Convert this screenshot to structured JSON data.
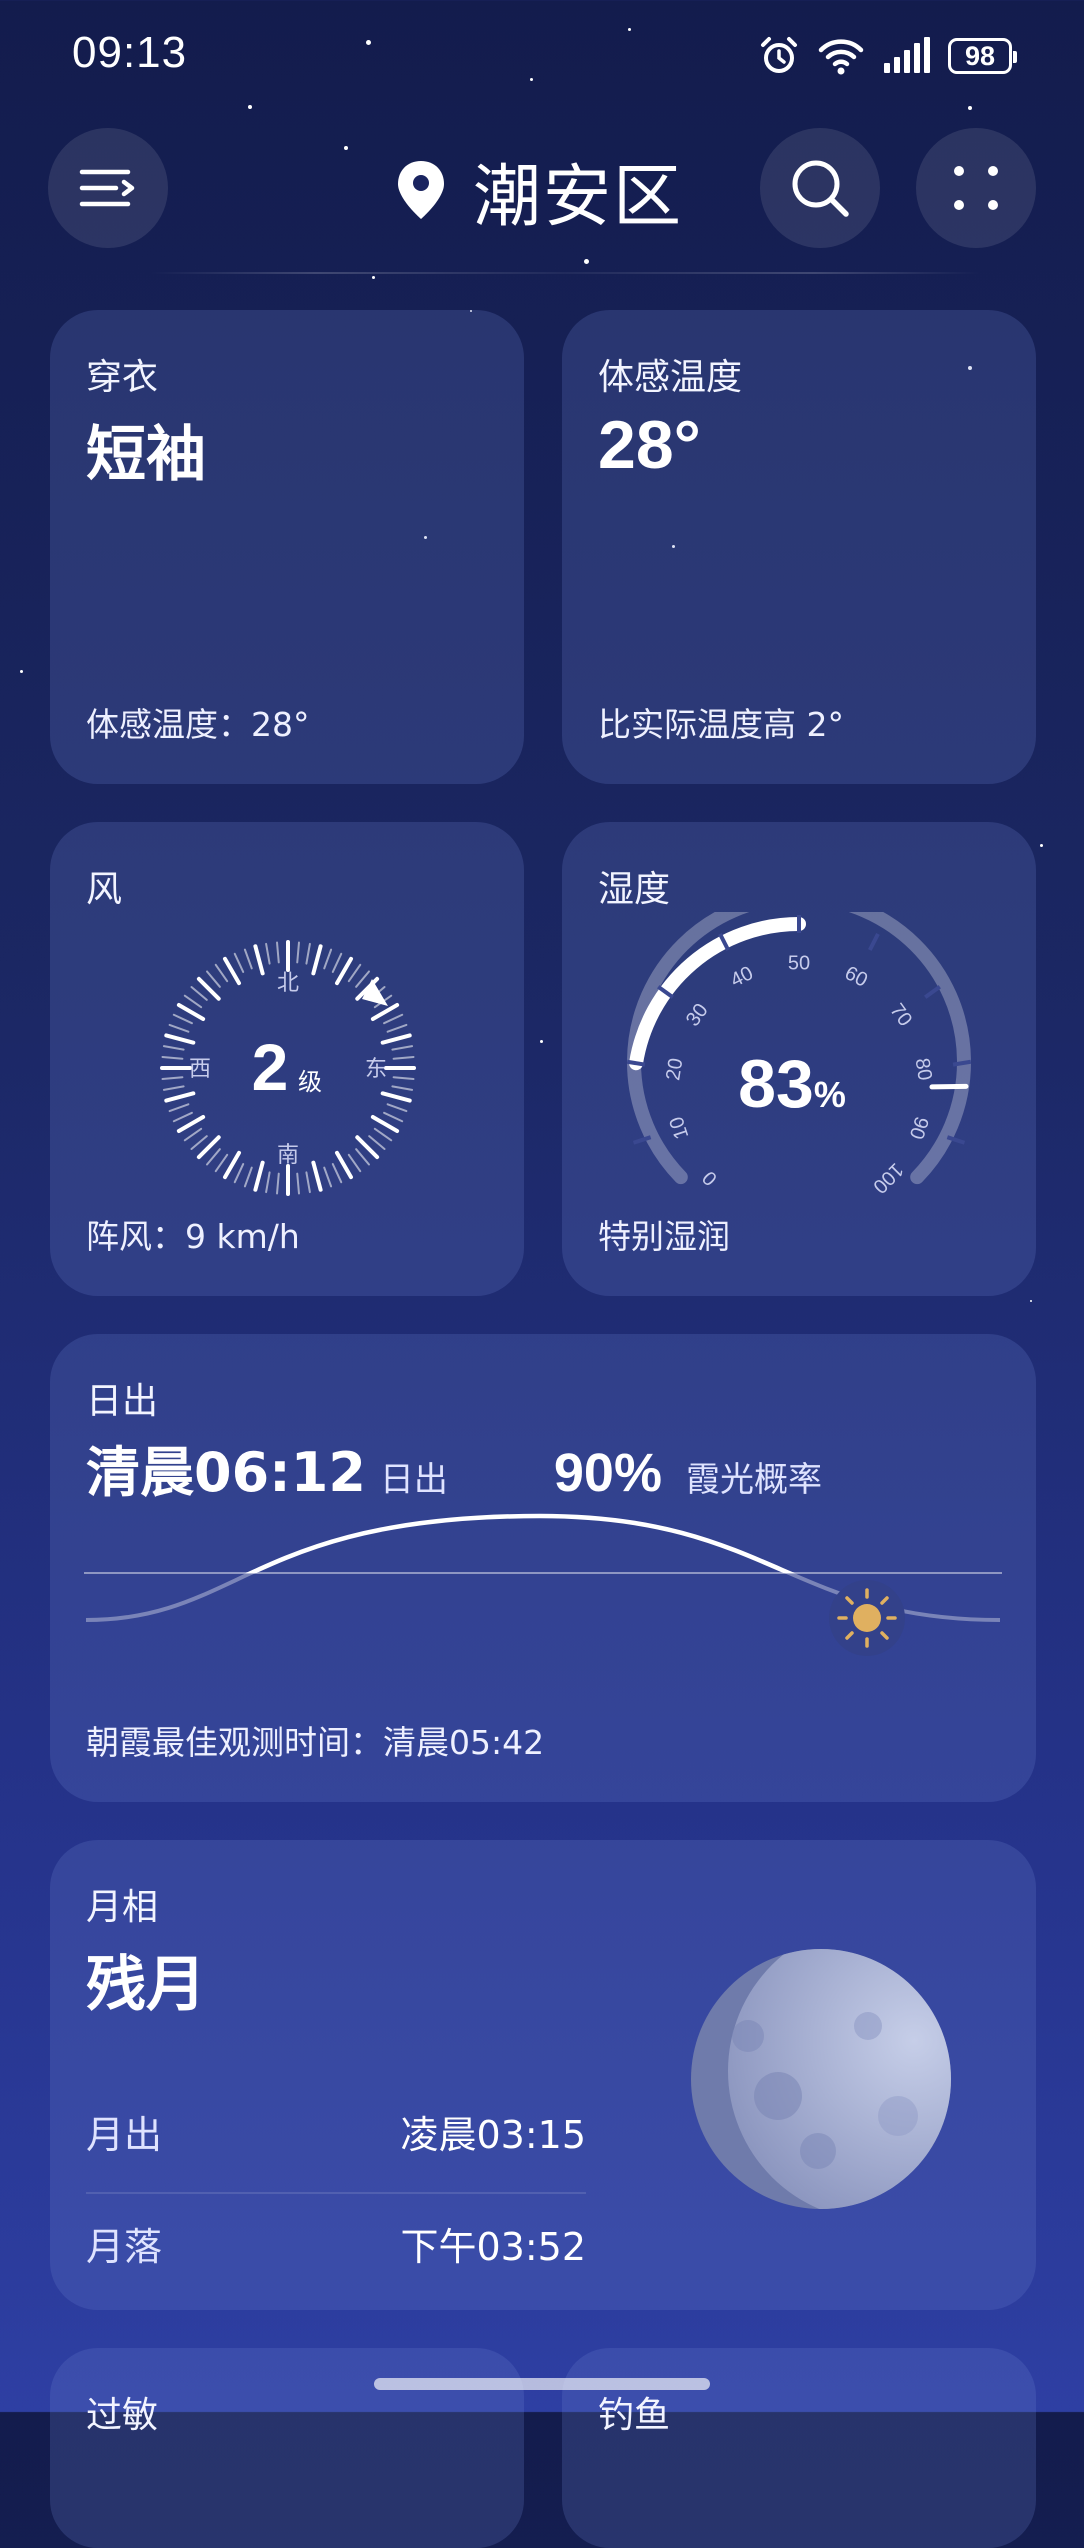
{
  "status_bar": {
    "time": "09:13",
    "battery": "98",
    "icons": [
      "alarm-icon",
      "wifi-icon",
      "signal-icon",
      "battery-icon"
    ]
  },
  "header": {
    "location": "潮安区",
    "icons": [
      "menu-icon",
      "location-pin-icon",
      "search-icon",
      "more-dots-icon"
    ]
  },
  "clothing": {
    "title": "穿衣",
    "value": "短袖",
    "detail": "体感温度：28°"
  },
  "feels_like": {
    "title": "体感温度",
    "value": "28°",
    "detail": "比实际温度高 2°"
  },
  "wind": {
    "title": "风",
    "level": "2",
    "level_unit": "级",
    "north": "北",
    "south": "南",
    "east": "东",
    "west": "西",
    "gust": "阵风：9 km/h"
  },
  "humidity": {
    "title": "湿度",
    "value": "83",
    "unit": "%",
    "fraction": 0.83,
    "scale": [
      "0",
      "10",
      "20",
      "30",
      "40",
      "50",
      "60",
      "70",
      "80",
      "90",
      "100"
    ],
    "description": "特别湿润"
  },
  "sunrise": {
    "title": "日出",
    "time": "清晨06:12",
    "time_label": "日出",
    "glow_percent": "90%",
    "glow_label": "霞光概率",
    "best_time": "朝霞最佳观测时间：清晨05:42"
  },
  "moon": {
    "title": "月相",
    "phase": "残月",
    "rise_label": "月出",
    "rise_time": "凌晨03:15",
    "set_label": "月落",
    "set_time": "下午03:52"
  },
  "bottom_cards": {
    "left_title": "过敏",
    "right_title": "钓鱼"
  },
  "colors": {
    "background_top": "#131c4d",
    "background_bottom": "#2e3fa3",
    "card": "#3b4a91",
    "sun": "#e0b060"
  }
}
